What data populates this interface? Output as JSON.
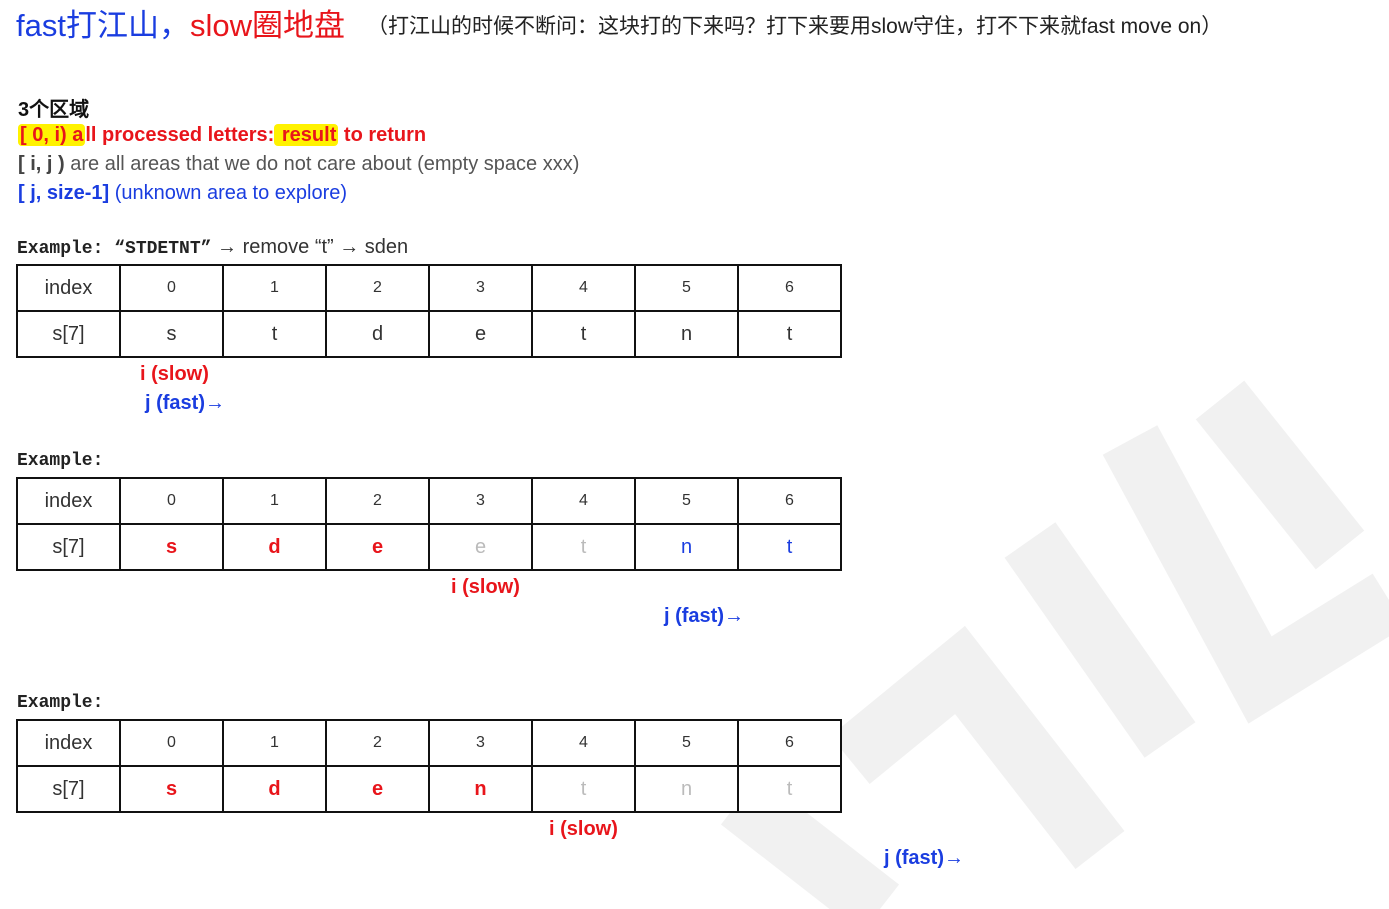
{
  "title": {
    "fast": "fast打江山，",
    "slow": "slow圈地盘",
    "note": "（打江山的时候不断问：这块打的下来吗？打下来要用slow守住，打不下来就fast move on）"
  },
  "regions": {
    "heading": "3个区域",
    "r1_hl1": "[ 0, i) a",
    "r1_mid": "ll processed letters:",
    "r1_hl2": " result",
    "r1_end": " to return",
    "r2_bold": "[ i, j )",
    "r2_text": " are all areas that we do not care about (empty space xxx)",
    "r3_bold": "[ j,  size-1]",
    "r3_text": "  (unknown area to explore)"
  },
  "examples": [
    {
      "label": "Example:",
      "extra": " “STDETNT”",
      "rest": " → remove “t” → sden",
      "index_label": "index",
      "row_label": "s[7]",
      "indices": [
        "0",
        "1",
        "2",
        "3",
        "4",
        "5",
        "6"
      ],
      "cells": [
        {
          "v": "s",
          "c": ""
        },
        {
          "v": "t",
          "c": ""
        },
        {
          "v": "d",
          "c": ""
        },
        {
          "v": "e",
          "c": ""
        },
        {
          "v": "t",
          "c": ""
        },
        {
          "v": "n",
          "c": ""
        },
        {
          "v": "t",
          "c": ""
        }
      ],
      "slow": "i (slow)",
      "fast": "j (fast)→"
    },
    {
      "label": "Example:",
      "extra": "",
      "rest": "",
      "index_label": "index",
      "row_label": "s[7]",
      "indices": [
        "0",
        "1",
        "2",
        "3",
        "4",
        "5",
        "6"
      ],
      "cells": [
        {
          "v": "s",
          "c": "red"
        },
        {
          "v": "d",
          "c": "red"
        },
        {
          "v": "e",
          "c": "red"
        },
        {
          "v": "e",
          "c": "grey"
        },
        {
          "v": "t",
          "c": "grey"
        },
        {
          "v": "n",
          "c": "blue"
        },
        {
          "v": "t",
          "c": "blue"
        }
      ],
      "slow": "i (slow)",
      "fast": "j (fast)→"
    },
    {
      "label": "Example:",
      "extra": "",
      "rest": "",
      "index_label": "index",
      "row_label": "s[7]",
      "indices": [
        "0",
        "1",
        "2",
        "3",
        "4",
        "5",
        "6"
      ],
      "cells": [
        {
          "v": "s",
          "c": "red"
        },
        {
          "v": "d",
          "c": "red"
        },
        {
          "v": "e",
          "c": "red"
        },
        {
          "v": "n",
          "c": "red"
        },
        {
          "v": "t",
          "c": "grey"
        },
        {
          "v": "n",
          "c": "grey"
        },
        {
          "v": "t",
          "c": "grey"
        }
      ],
      "slow": "i (slow)",
      "fast": "j (fast)→"
    }
  ],
  "colors": {
    "red": "#e8151b",
    "blue": "#1a3de0",
    "highlight": "#fff200",
    "watermark": "#f2f2f2"
  }
}
